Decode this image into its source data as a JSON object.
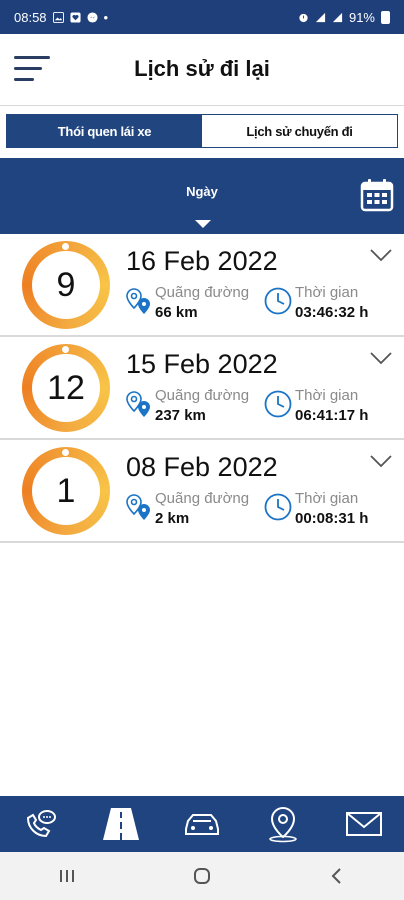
{
  "status_bar": {
    "time": "08:58",
    "battery": "91%"
  },
  "header": {
    "title": "Lịch sử đi lại"
  },
  "tabs": [
    {
      "label": "Thói quen lái xe",
      "active": true
    },
    {
      "label": "Lịch sử chuyến đi",
      "active": false
    }
  ],
  "filter": {
    "period": "Ngày"
  },
  "trips": [
    {
      "score": "9",
      "date": "16 Feb 2022",
      "distance_label": "Quãng đường",
      "distance": "66 km",
      "time_label": "Thời gian",
      "duration": "03:46:32 h"
    },
    {
      "score": "12",
      "date": "15 Feb 2022",
      "distance_label": "Quãng đường",
      "distance": "237 km",
      "time_label": "Thời gian",
      "duration": "06:41:17 h"
    },
    {
      "score": "1",
      "date": "08 Feb 2022",
      "distance_label": "Quãng đường",
      "distance": "2 km",
      "time_label": "Thời gian",
      "duration": "00:08:31 h"
    }
  ],
  "bottom_nav": [
    {
      "icon": "phone-chat-icon"
    },
    {
      "icon": "road-icon",
      "active": true
    },
    {
      "icon": "car-icon"
    },
    {
      "icon": "location-pin-icon"
    },
    {
      "icon": "mail-icon"
    }
  ],
  "colors": {
    "primary": "#1f4480",
    "ring_start": "#f8c447",
    "ring_end": "#ee7f22"
  }
}
